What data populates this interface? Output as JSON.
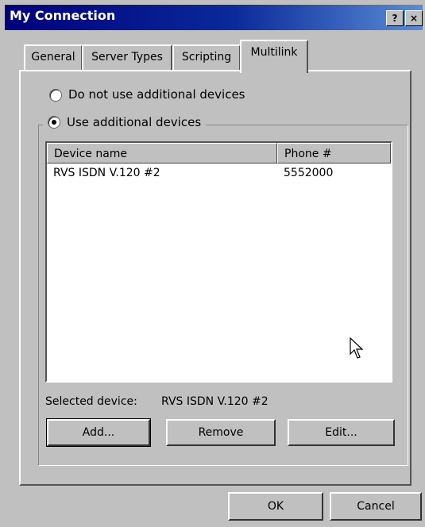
{
  "window": {
    "title": "My Connection",
    "help_glyph": "?",
    "close_glyph": "×"
  },
  "tabs": [
    {
      "label": "General"
    },
    {
      "label": "Server Types"
    },
    {
      "label": "Scripting"
    },
    {
      "label": "Multilink"
    }
  ],
  "options": {
    "no_devices": "Do not use additional devices",
    "use_devices": "Use additional devices"
  },
  "list": {
    "col_device": "Device name",
    "col_phone": "Phone #",
    "rows": [
      {
        "device": "RVS ISDN V.120 #2",
        "phone": "5552000"
      }
    ]
  },
  "selected": {
    "label": "Selected device:",
    "value": "RVS ISDN V.120 #2"
  },
  "buttons": {
    "add": "Add...",
    "remove": "Remove",
    "edit": "Edit...",
    "ok": "OK",
    "cancel": "Cancel"
  },
  "colors": {
    "titlebar": "#00007c",
    "face": "#c0c0c0"
  }
}
